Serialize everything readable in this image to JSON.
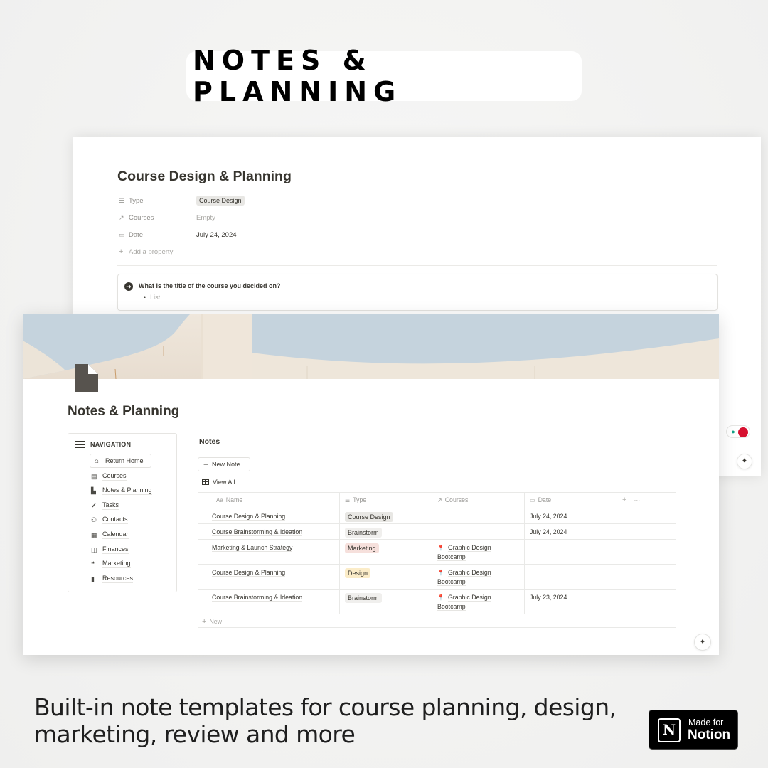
{
  "headline": "NOTES & PLANNING",
  "back_window": {
    "title": "Course Design & Planning",
    "properties": [
      {
        "icon": "list-icon",
        "glyph": "☰",
        "label": "Type",
        "value": "Course Design",
        "style": "chip"
      },
      {
        "icon": "arrow-up-right-icon",
        "glyph": "↗",
        "label": "Courses",
        "value": "Empty",
        "style": "empty"
      },
      {
        "icon": "calendar-icon",
        "glyph": "▭",
        "label": "Date",
        "value": "July 24, 2024",
        "style": "text"
      }
    ],
    "add_property": "Add a property",
    "callout": {
      "question": "What is the title of the course you decided on?",
      "bullet": "List"
    }
  },
  "front_window": {
    "page_title": "Notes & Planning",
    "navigation": {
      "heading": "NAVIGATION",
      "return_home": "Return Home",
      "items": [
        {
          "label": "Courses",
          "icon": "archive-icon",
          "glyph": "▤"
        },
        {
          "label": "Notes & Planning",
          "icon": "document-icon",
          "glyph": "▙"
        },
        {
          "label": "Tasks",
          "icon": "check-circle-icon",
          "glyph": "✔"
        },
        {
          "label": "Contacts",
          "icon": "people-icon",
          "glyph": "👥"
        },
        {
          "label": "Calendar",
          "icon": "calendar-icon",
          "glyph": "▦"
        },
        {
          "label": "Finances",
          "icon": "money-icon",
          "glyph": "◫"
        },
        {
          "label": "Marketing",
          "icon": "chat-bubbles-icon",
          "glyph": "❝"
        },
        {
          "label": "Resources",
          "icon": "book-icon",
          "glyph": "▮"
        }
      ]
    },
    "notes": {
      "heading": "Notes",
      "new_note_label": "New Note",
      "view_label": "View All",
      "columns": [
        {
          "label": "Name",
          "glyph": "Aa"
        },
        {
          "label": "Type",
          "glyph": "☰"
        },
        {
          "label": "Courses",
          "glyph": "↗"
        },
        {
          "label": "Date",
          "glyph": "▭"
        }
      ],
      "rows": [
        {
          "name": "Course Design & Planning",
          "type": "Course Design",
          "type_color": "gray",
          "course": "",
          "date": "July 24, 2024"
        },
        {
          "name": "Course Brainstorming & Ideation",
          "type": "Brainstorm",
          "type_color": "light",
          "course": "",
          "date": "July 24, 2024"
        },
        {
          "name": "Marketing & Launch Strategy",
          "type": "Marketing",
          "type_color": "red",
          "course": "Graphic Design Bootcamp",
          "date": ""
        },
        {
          "name": "Course Design & Planning",
          "type": "Design",
          "type_color": "yellow",
          "course": "Graphic Design Bootcamp",
          "date": ""
        },
        {
          "name": "Course Brainstorming & Ideation",
          "type": "Brainstorm",
          "type_color": "light",
          "course": "Graphic Design Bootcamp",
          "date": "July 23, 2024"
        }
      ],
      "new_row_label": "New"
    }
  },
  "caption": "Built-in note templates for course planning, design, marketing, review and more",
  "badge": {
    "line1": "Made for",
    "line2": "Notion",
    "logo": "N"
  },
  "colors": {
    "text": "#37352f",
    "chip_gray": "#e8e7e4",
    "chip_red": "#f6e0dc",
    "chip_yellow": "#fbecc8",
    "grammarly_green": "#12a286",
    "widget_red": "#d6102f"
  }
}
